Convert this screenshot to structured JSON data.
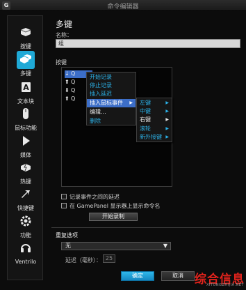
{
  "window": {
    "title": "命令编辑器",
    "logo": "G"
  },
  "sidebar": {
    "items": [
      {
        "label": "按键",
        "icon": "key-icon"
      },
      {
        "label": "多键",
        "icon": "multikey-icon",
        "active": true
      },
      {
        "label": "文本块",
        "icon": "text-block-icon"
      },
      {
        "label": "鼠标功能",
        "icon": "mouse-icon"
      },
      {
        "label": "媒体",
        "icon": "play-icon"
      },
      {
        "label": "热键",
        "icon": "hotkey-icon"
      },
      {
        "label": "快捷键",
        "icon": "shortcut-arrow-icon"
      },
      {
        "label": "功能",
        "icon": "gear-icon"
      },
      {
        "label": "Ventrilo",
        "icon": "ventrilo-icon"
      }
    ]
  },
  "main": {
    "title": "多键",
    "name_label": "名称：",
    "name_value": "组",
    "keys_label": "按键",
    "key_rows": [
      {
        "arrow": "↓",
        "key": "Q",
        "selected": true
      },
      {
        "arrow": "⬆",
        "key": "Q"
      },
      {
        "arrow": "⬇",
        "key": "Q"
      },
      {
        "arrow": "⬆",
        "key": "Q"
      }
    ],
    "context_menu": [
      "开始记录",
      "停止记录",
      "插入延迟",
      "插入鼠标事件",
      "编辑...",
      "删除"
    ],
    "submenu": [
      "左键",
      "中键",
      "右键",
      "滚轮",
      "新外接键"
    ],
    "checkbox1": "记录事件之间的延迟",
    "checkbox2": "在 GamePanel 显示器上显示命令名",
    "record_button": "开始录制",
    "repeat_label": "重复选项",
    "repeat_value": "无",
    "delay_label": "延迟（毫秒）：",
    "delay_value": "25",
    "ok_button": "确定",
    "cancel_button": "取消"
  },
  "watermark": {
    "main": "综合信息",
    "sub": "XITONGZHIJIA.NET"
  },
  "colors": {
    "accent": "#1fa9d6",
    "highlight": "#3c6ec8",
    "watermark": "#e3231c"
  }
}
